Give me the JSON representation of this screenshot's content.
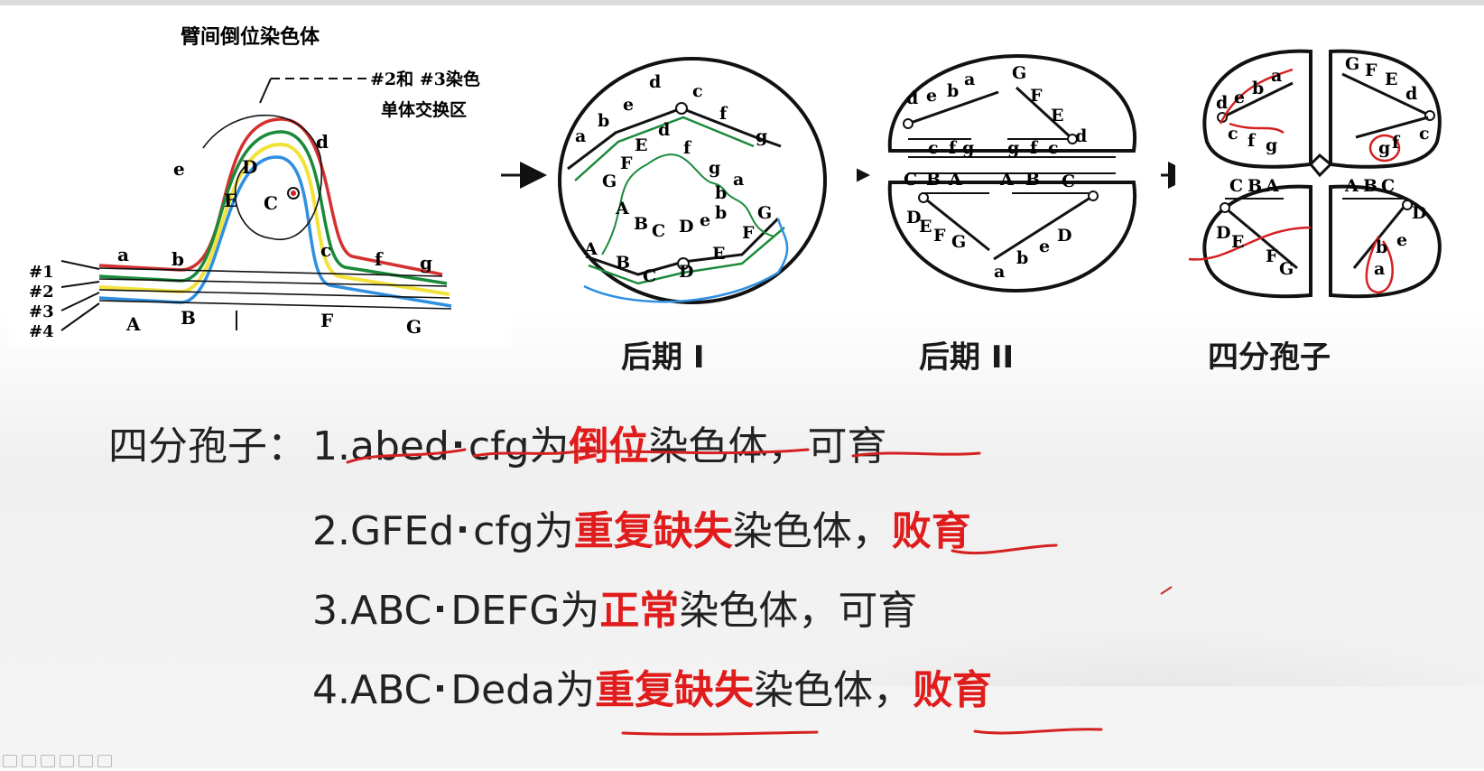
{
  "loop_figure": {
    "title": "臂间倒位染色体",
    "exchange_label": "#2和 #3染色",
    "exchange_label_2": "单体交换区",
    "strand_labels": [
      "#1",
      "#2",
      "#3",
      "#4"
    ],
    "genes_top": [
      "a",
      "b",
      "c",
      "f",
      "g"
    ],
    "genes_bottom": [
      "A",
      "B",
      "F",
      "G"
    ],
    "loop_genes": [
      "D",
      "E",
      "C",
      "d",
      "e"
    ]
  },
  "stage_labels": {
    "anaphase1": "后期 I",
    "anaphase2": "后期 II",
    "tetrad": "四分孢子"
  },
  "notes": {
    "heading": "四分孢子：",
    "items": [
      {
        "num": "1.",
        "seq1": "abed",
        "seq2": "cfg",
        "mid": "为",
        "highlight": "倒位",
        "rest": "染色体，",
        "result": "可育",
        "result_red": false
      },
      {
        "num": "2.",
        "seq1": "GFEd",
        "seq2": "cfg",
        "mid": "为",
        "highlight": "重复缺失",
        "rest": "染色体，",
        "result": "败育",
        "result_red": true
      },
      {
        "num": "3.",
        "seq1": "ABC",
        "seq2": "DEFG",
        "mid": "为",
        "highlight": "正常",
        "rest": "染色体，",
        "result": "可育",
        "result_red": false
      },
      {
        "num": "4.",
        "seq1": "ABC",
        "seq2": "Deda",
        "mid": "为",
        "highlight": "重复缺失",
        "rest": "染色体，",
        "result": "败育",
        "result_red": true
      }
    ]
  },
  "colors": {
    "accent_red": "#e01c1c",
    "ink_red": "#d42020",
    "green": "#1a8a3a",
    "blue": "#2f8fe0",
    "yellow": "#f3e23a"
  }
}
